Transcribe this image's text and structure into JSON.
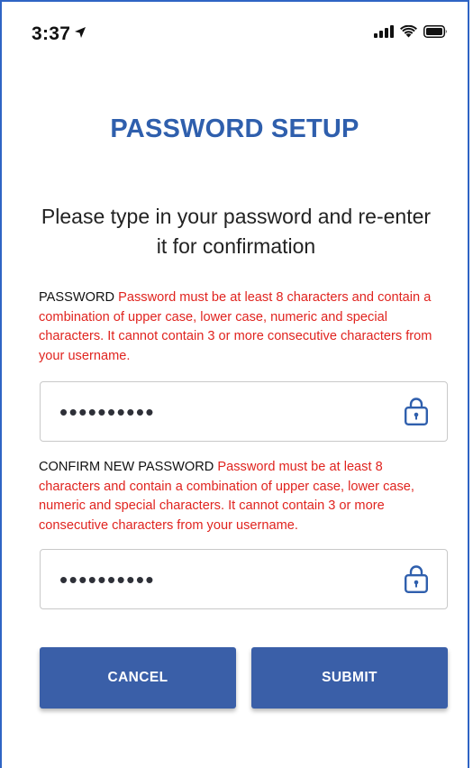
{
  "status_bar": {
    "time": "3:37",
    "location_icon": "location-arrow-icon",
    "signal_icon": "cellular-signal-icon",
    "wifi_icon": "wifi-icon",
    "battery_icon": "battery-icon"
  },
  "title": "PASSWORD SETUP",
  "instructions": "Please type in your password and re-enter it for confirmation",
  "password_field": {
    "label": "PASSWORD",
    "requirement": "Password must be at least 8 characters and contain a combination of upper case, lower case, numeric and special characters. It cannot contain 3 or more consecutive characters from your username.",
    "masked_value": "••••••••••",
    "icon": "lock-icon"
  },
  "confirm_field": {
    "label": "CONFIRM NEW PASSWORD",
    "requirement": "Password must be at least 8 characters and contain a combination of upper case, lower case, numeric and special characters. It cannot contain 3 or more consecutive characters from your username.",
    "masked_value": "••••••••••",
    "icon": "lock-icon"
  },
  "buttons": {
    "cancel_label": "CANCEL",
    "submit_label": "SUBMIT"
  },
  "colors": {
    "title": "#2f5fad",
    "requirement_text": "#e0241f",
    "button_bg": "#3a5fa8",
    "frame_border": "#2f64c4"
  }
}
